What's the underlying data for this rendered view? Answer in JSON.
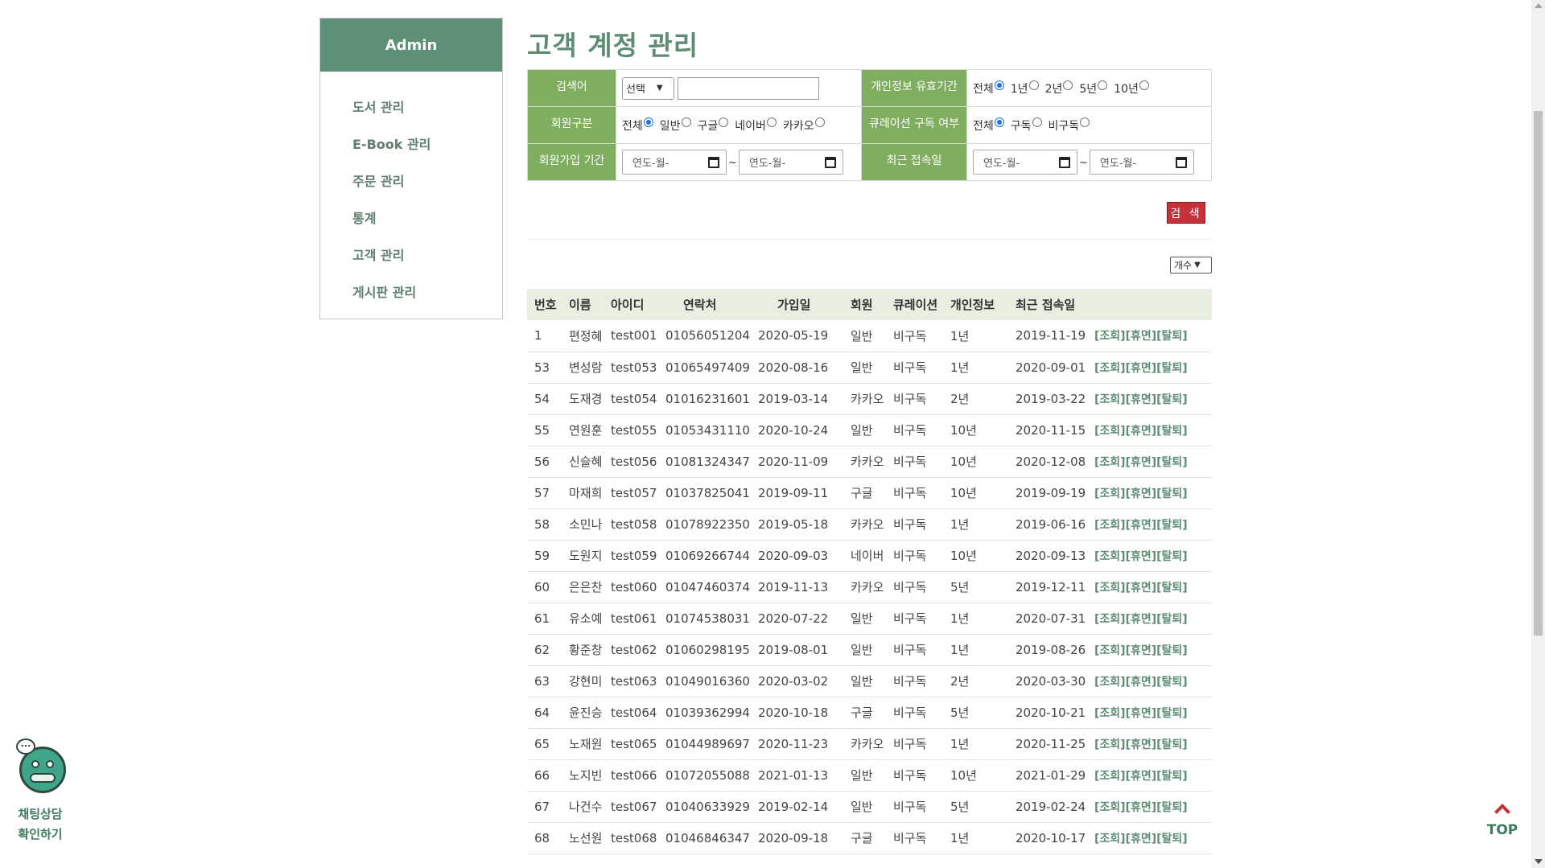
{
  "sidebar": {
    "title": "Admin",
    "items": [
      {
        "label": "도서 관리"
      },
      {
        "label": "E-Book 관리"
      },
      {
        "label": "주문 관리"
      },
      {
        "label": "통계"
      },
      {
        "label": "고객 관리"
      },
      {
        "label": "게시판 관리"
      }
    ]
  },
  "page_title": "고객 계정 관리",
  "search": {
    "keyword_label": "검색어",
    "keyword_select": "선택",
    "keyword_value": "",
    "privacy_label": "개인정보 유효기간",
    "privacy_options": [
      {
        "label": "전체",
        "checked": true
      },
      {
        "label": "1년",
        "checked": false
      },
      {
        "label": "2년",
        "checked": false
      },
      {
        "label": "5년",
        "checked": false
      },
      {
        "label": "10년",
        "checked": false
      }
    ],
    "member_type_label": "회원구분",
    "member_type_options": [
      {
        "label": "전체",
        "checked": true
      },
      {
        "label": "일반",
        "checked": false
      },
      {
        "label": "구글",
        "checked": false
      },
      {
        "label": "네이버",
        "checked": false
      },
      {
        "label": "카카오",
        "checked": false
      }
    ],
    "curation_label": "큐레이션 구독 여부",
    "curation_options": [
      {
        "label": "전체",
        "checked": true
      },
      {
        "label": "구독",
        "checked": false
      },
      {
        "label": "비구독",
        "checked": false
      }
    ],
    "join_period_label": "회원가입 기간",
    "last_login_label": "최근 접속일",
    "date_placeholder": "연도-월-",
    "tilde": "~",
    "button_label": "검 색"
  },
  "count_select": "개수",
  "table": {
    "headers": [
      "번호",
      "이름",
      "아이디",
      "연락처",
      "가입일",
      "회원",
      "큐레이션",
      "개인정보",
      "최근 접속일"
    ],
    "action_labels": [
      "[조회]",
      "[휴면]",
      "[탈퇴]"
    ],
    "rows": [
      [
        "1",
        "편정혜",
        "test001",
        "01056051204",
        "2020-05-19",
        "일반",
        "비구독",
        "1년",
        "2019-11-19"
      ],
      [
        "53",
        "변성람",
        "test053",
        "01065497409",
        "2020-08-16",
        "일반",
        "비구독",
        "1년",
        "2020-09-01"
      ],
      [
        "54",
        "도재경",
        "test054",
        "01016231601",
        "2019-03-14",
        "카카오",
        "비구독",
        "2년",
        "2019-03-22"
      ],
      [
        "55",
        "연원훈",
        "test055",
        "01053431110",
        "2020-10-24",
        "일반",
        "비구독",
        "10년",
        "2020-11-15"
      ],
      [
        "56",
        "신슬혜",
        "test056",
        "01081324347",
        "2020-11-09",
        "카카오",
        "비구독",
        "10년",
        "2020-12-08"
      ],
      [
        "57",
        "마재희",
        "test057",
        "01037825041",
        "2019-09-11",
        "구글",
        "비구독",
        "10년",
        "2019-09-19"
      ],
      [
        "58",
        "소민나",
        "test058",
        "01078922350",
        "2019-05-18",
        "카카오",
        "비구독",
        "1년",
        "2019-06-16"
      ],
      [
        "59",
        "도원지",
        "test059",
        "01069266744",
        "2020-09-03",
        "네이버",
        "비구독",
        "10년",
        "2020-09-13"
      ],
      [
        "60",
        "은은찬",
        "test060",
        "01047460374",
        "2019-11-13",
        "카카오",
        "비구독",
        "5년",
        "2019-12-11"
      ],
      [
        "61",
        "유소예",
        "test061",
        "01074538031",
        "2020-07-22",
        "일반",
        "비구독",
        "1년",
        "2020-07-31"
      ],
      [
        "62",
        "황준창",
        "test062",
        "01060298195",
        "2019-08-01",
        "일반",
        "비구독",
        "1년",
        "2019-08-26"
      ],
      [
        "63",
        "강현미",
        "test063",
        "01049016360",
        "2020-03-02",
        "일반",
        "비구독",
        "2년",
        "2020-03-30"
      ],
      [
        "64",
        "윤진승",
        "test064",
        "01039362994",
        "2020-10-18",
        "구글",
        "비구독",
        "5년",
        "2020-10-21"
      ],
      [
        "65",
        "노재원",
        "test065",
        "01044989697",
        "2020-11-23",
        "카카오",
        "비구독",
        "1년",
        "2020-11-25"
      ],
      [
        "66",
        "노지빈",
        "test066",
        "01072055088",
        "2021-01-13",
        "일반",
        "비구독",
        "10년",
        "2021-01-29"
      ],
      [
        "67",
        "나건수",
        "test067",
        "01040633929",
        "2019-02-14",
        "일반",
        "비구독",
        "5년",
        "2019-02-24"
      ],
      [
        "68",
        "노선원",
        "test068",
        "01046846347",
        "2020-09-18",
        "구글",
        "비구독",
        "1년",
        "2020-10-17"
      ]
    ]
  },
  "chat": {
    "line1": "채팅상담",
    "line2": "확인하기",
    "bubble": "..."
  },
  "top_label": "TOP",
  "colors": {
    "brand_green": "#5e9276",
    "label_green": "#7fae60",
    "search_red": "#c8313a"
  }
}
